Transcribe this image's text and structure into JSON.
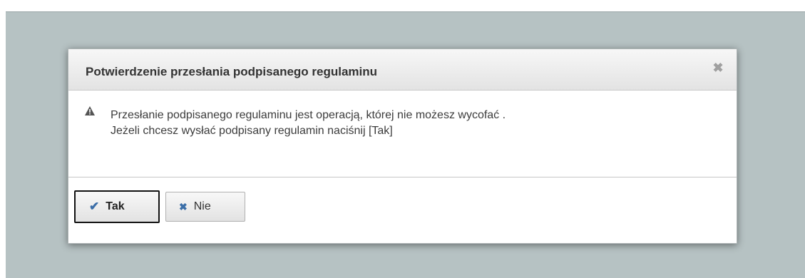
{
  "dialog": {
    "title": "Potwierdzenie przesłania podpisanego regulaminu",
    "close_icon": "close-icon",
    "warning_icon": "warning-icon",
    "message_line1": "Przesłanie podpisanego regulaminu jest operacją, której nie możesz wycofać .",
    "message_line2": "Jeżeli chcesz wysłać podpisany regulamin naciśnij [Tak]"
  },
  "buttons": {
    "yes_label": "Tak",
    "yes_icon": "check-icon",
    "no_label": "Nie",
    "no_icon": "cross-icon"
  },
  "colors": {
    "backdrop": "#b6c2c3",
    "icon_accent": "#3b6ea8",
    "text": "#3c3c3c"
  }
}
